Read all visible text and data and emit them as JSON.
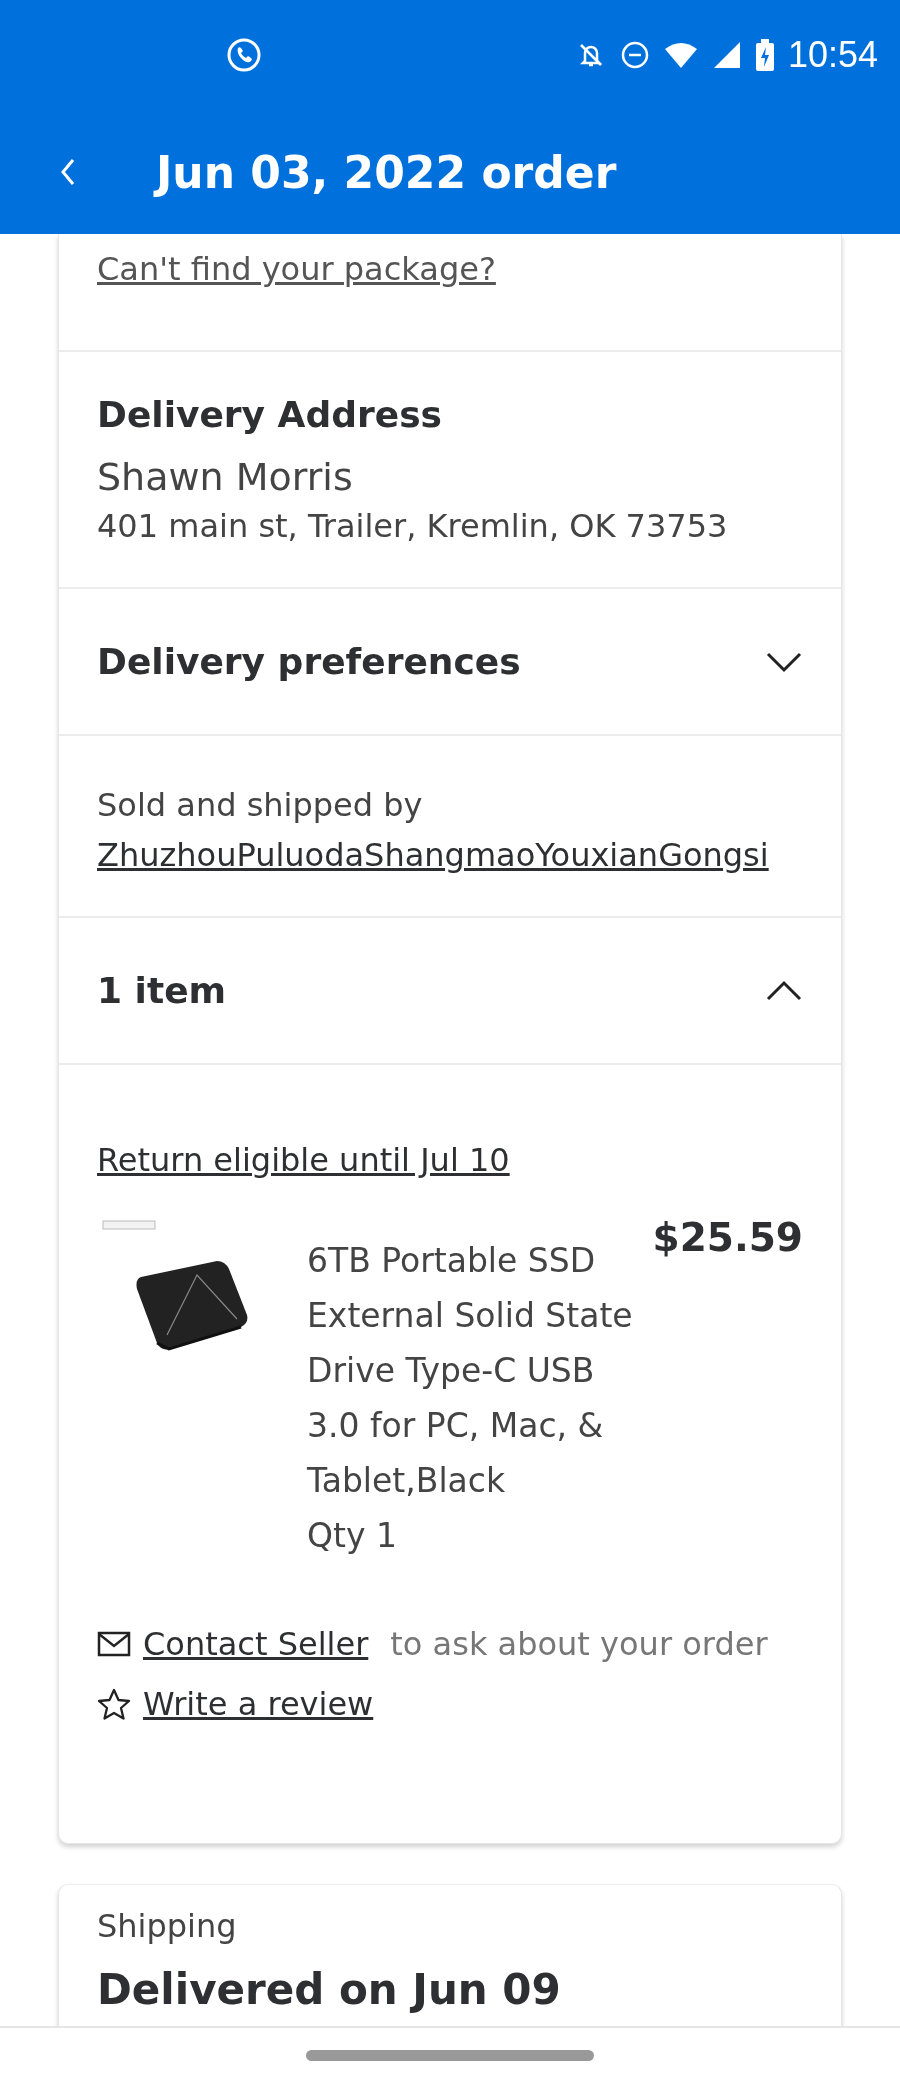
{
  "status_bar": {
    "time": "10:54"
  },
  "header": {
    "title": "Jun 03, 2022 order"
  },
  "tracking": {
    "link": "Can't find your package?"
  },
  "delivery_address": {
    "title": "Delivery Address",
    "name": "Shawn Morris",
    "address": "401 main st, Trailer, Kremlin, OK 73753"
  },
  "delivery_preferences": {
    "title": "Delivery preferences",
    "expanded": false
  },
  "seller": {
    "label": "Sold and shipped by",
    "name": "ZhuzhouPuluodaShangmaoYouxianGongsi"
  },
  "items_section": {
    "title": "1 item",
    "expanded": true,
    "return_note": "Return eligible until Jul 10",
    "items": [
      {
        "kind": "picture",
        "name": "6TB Portable SSD External Solid State Drive Type-C USB 3.0 for PC, Mac, & Tablet,Black",
        "qty": "Qty 1",
        "price": "$25.59"
      }
    ],
    "actions": [
      {
        "kind": "contact",
        "link": "Contact Seller",
        "note": "to ask about your order"
      },
      {
        "kind": "review",
        "link": "Write a review"
      }
    ]
  },
  "shipping": {
    "label": "Shipping",
    "status": "Delivered on Jun 09"
  }
}
